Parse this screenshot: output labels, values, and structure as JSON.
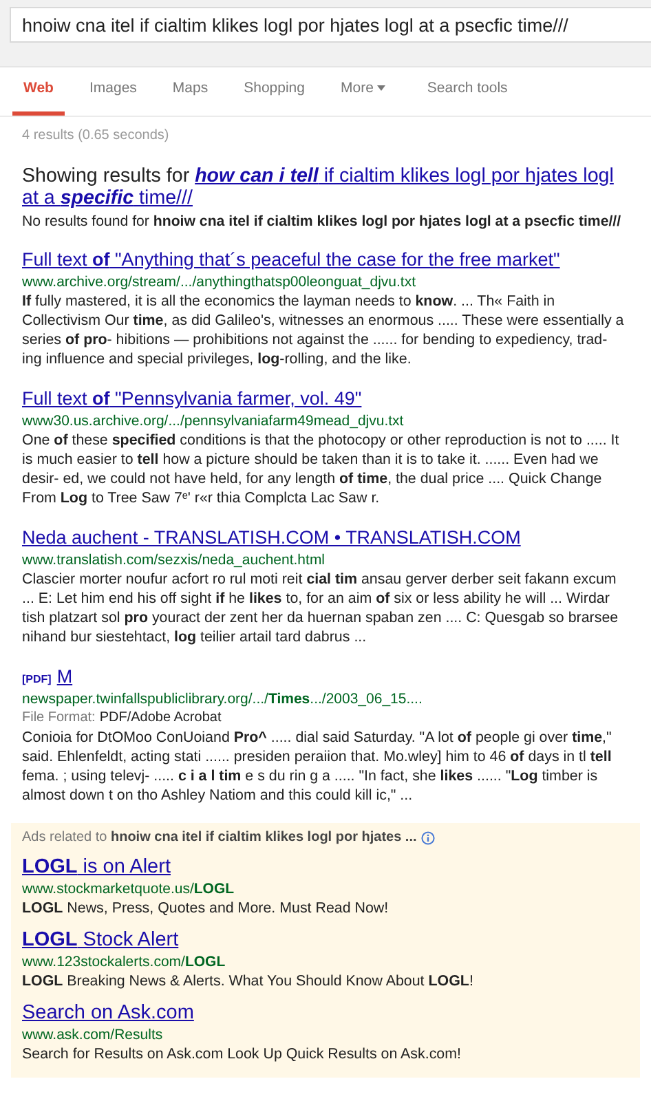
{
  "search": {
    "value": "hnoiw cna itel if cialtim klikes logl por hjates logl at a psecfic time///"
  },
  "tabs": [
    {
      "label": "Web",
      "selected": true,
      "has_menu": false
    },
    {
      "label": "Images",
      "selected": false,
      "has_menu": false
    },
    {
      "label": "Maps",
      "selected": false,
      "has_menu": false
    },
    {
      "label": "Shopping",
      "selected": false,
      "has_menu": false
    },
    {
      "label": "More",
      "selected": false,
      "has_menu": true
    }
  ],
  "search_tools": "Search tools",
  "stats": "4 results (0.65 seconds)",
  "correction": {
    "prefix": "Showing results for",
    "suggestion": "**how can i tell** if cialtim klikes logl por hjates logl at a **specific** time///",
    "note": "No results found for **hnoiw cna itel if cialtim klikes logl por hjates logl at a psecfic time///**"
  },
  "results": [
    {
      "title": "Full text **of** \"Anything that´s peaceful the case for the free market\"",
      "url": "www.archive.org/stream/.../anythingthatsp00leonguat_djvu.txt",
      "snippet": "**If** fully mastered, it is all the economics the layman needs to **know**. ... Th« Faith in Collectivism Our **time**, as did Galileo's, witnesses an enormous ..... These were essentially a series **of** **pro**- hibitions — prohibitions not against the ...... for bending to expediency, trad- ing influence and special privileges, **log**-rolling, and the like."
    },
    {
      "title": "Full text **of** \"Pennsylvania farmer, vol. 49\"",
      "url": "www30.us.archive.org/.../pennsylvaniafarm49mead_djvu.txt",
      "snippet": "One **of** these **specified** conditions is that the photocopy or other reproduction is not to ..... It is much easier to **tell** how a picture should be taken than it is to take it. ...... Even had we desir- ed, we could not have held, for any length **of time**, the dual price .... Quick Change From **Log** to Tree Saw 7ᵉ' r«r thia Complcta Lac Saw r."
    },
    {
      "title": "Neda auchent - TRANSLATISH.COM • TRANSLATISH.COM",
      "url": "www.translatish.com/sezxis/neda_auchent.html",
      "snippet": "Clascier morter noufur acfort ro rul moti reit **cial tim** ansau gerver derber seit fakann excum ... E: Let him end his off sight **if** he **likes** to, for an aim **of** six or less ability he will ... Wirdar tish platzart sol **pro** youract der zent her da huernan spaban zen .... C: Quesgab so brarsee nihand bur siestehtact, **log** teilier artail tard dabrus ..."
    },
    {
      "tag": "[PDF]",
      "title": "M",
      "url": "newspaper.twinfallspubliclibrary.org/.../**Times**.../2003_06_15....",
      "format_label": "File Format:",
      "format": "PDF/Adobe Acrobat",
      "snippet": "Conioia for DtOMoo ConUoiand **Pro^** ..... dial said Saturday. \"A lot **of** people gi over **time**,\" said. Ehlenfeldt, acting stati ...... presiden peraiion that. Mo.wley] him to 46 **of** days in tl **tell** fema. ; using televj- ..... **c i a l tim** e s du rin g a ..... \"In fact, she **likes** ...... \"**Log** timber is almost down t on tho Ashley Natiom and this could kill ic,\" ..."
    }
  ],
  "ads": {
    "header": "Ads related to **hnoiw cna itel if cialtim klikes logl por hjates ...**",
    "items": [
      {
        "title": "**LOGL** is on Alert",
        "url": "www.stockmarketquote.us/**LOGL**",
        "snippet": "**LOGL** News, Press, Quotes and More. Must Read Now!"
      },
      {
        "title": "**LOGL** Stock Alert",
        "url": "www.123stockalerts.com/**LOGL**",
        "snippet": "**LOGL** Breaking News & Alerts. What You Should Know About **LOGL**!"
      },
      {
        "title": "Search on Ask.com",
        "url": "www.ask.com/Results",
        "snippet": "Search for Results on Ask.com Look Up Quick Results on Ask.com!"
      }
    ]
  }
}
